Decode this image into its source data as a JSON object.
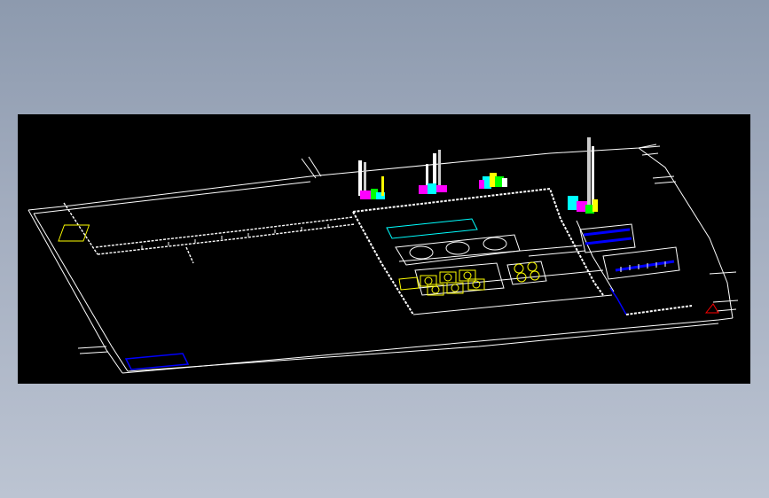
{
  "app": {
    "background_top": "#8d9aae",
    "background_bottom": "#bcc4d2"
  },
  "viewport": {
    "background": "#000000"
  },
  "colors": {
    "line": "#ffffff",
    "equipment_yellow": "#ffff00",
    "equipment_cyan": "#00ffff",
    "equipment_magenta": "#ff00ff",
    "equipment_green": "#00ff00",
    "highlight_blue": "#0000ff",
    "marker_red": "#ff0000"
  },
  "icons": {
    "north_arrow": "triangle-marker-icon"
  }
}
